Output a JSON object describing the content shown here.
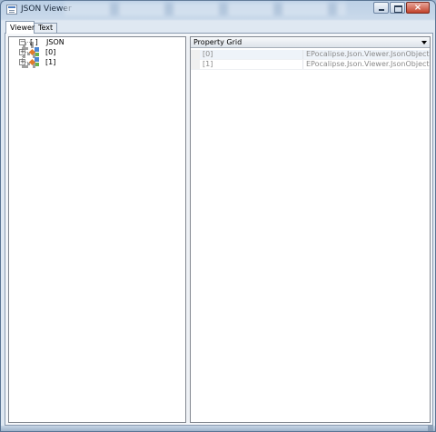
{
  "window": {
    "title": "JSON Viewer"
  },
  "tabs": [
    {
      "label": "Viewer",
      "active": true
    },
    {
      "label": "Text",
      "active": false
    }
  ],
  "tree": {
    "root": {
      "bracket": "[ ]",
      "label": "JSON",
      "expanded": true
    },
    "children": [
      {
        "label": "[0]",
        "expanded": false,
        "icon": "json-object-icon"
      },
      {
        "label": "[1]",
        "expanded": false,
        "icon": "json-object-icon"
      }
    ]
  },
  "property_grid": {
    "selector_label": "Property Grid",
    "rows": [
      {
        "name": "[0]",
        "value": "EPocalipse.Json.Viewer.JsonObject"
      },
      {
        "name": "[1]",
        "value": "EPocalipse.Json.Viewer.JsonObject"
      }
    ]
  },
  "icons": {
    "expand": "plus-box-icon",
    "collapse": "minus-box-icon",
    "dropdown": "chevron-down-icon"
  },
  "colors": {
    "titlebar": "#bcd0e6",
    "close_button": "#c2432c",
    "pane_border": "#828790"
  }
}
